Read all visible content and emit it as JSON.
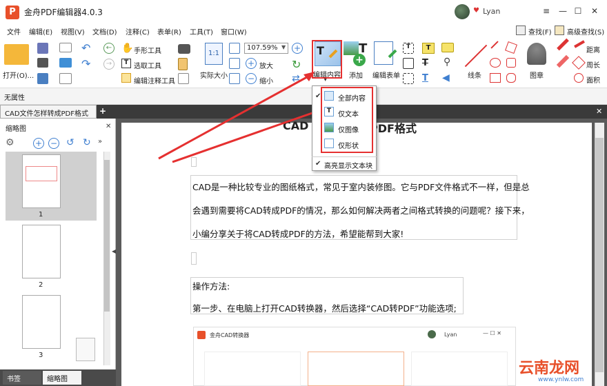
{
  "app": {
    "title": "金舟PDF编辑器4.0.3",
    "logo": "P",
    "user": "Lyan"
  },
  "window_controls": {
    "menu": "≡",
    "minimize": "—",
    "maximize": "☐",
    "close": "✕"
  },
  "menubar": [
    "文件",
    "编辑(E)",
    "视图(V)",
    "文档(D)",
    "注释(C)",
    "表单(R)",
    "工具(T)",
    "窗口(W)"
  ],
  "search": {
    "find": "查找(F)",
    "advanced": "高级查找(S)"
  },
  "ribbon": {
    "open": "打开(O)...",
    "hand_tool": "手形工具",
    "select_tool": "选取工具",
    "annot_tool": "编辑注释工具",
    "actual_size": "实际大小",
    "zoom_value": "107.59%",
    "zoom_in": "放大",
    "zoom_out": "缩小",
    "edit_content": "编辑内容",
    "add": "添加",
    "edit_form": "编辑表单",
    "line": "线条",
    "stamp": "图章",
    "distance": "距离",
    "perimeter": "周长",
    "area": "面积"
  },
  "propbar": {
    "label": "无属性"
  },
  "tabs": {
    "doc_tab": "CAD文件怎样转成PDF格式",
    "new_tab": "+",
    "close": "✕"
  },
  "sidebar": {
    "title": "缩略图",
    "close": "✕",
    "pages": [
      "1",
      "2",
      "3"
    ],
    "bottom_tabs": [
      "书签",
      "缩略图"
    ]
  },
  "dropdown": {
    "items": [
      "全部内容",
      "仅文本",
      "仅图像",
      "仅形状"
    ],
    "extra": "高亮显示文本块"
  },
  "document": {
    "heading_left": "CAD",
    "heading_right": "成PDF格式",
    "para1": [
      "CAD是一种比较专业的图纸格式，常见于室内装修图。它与PDF文件格式不一样，但是总",
      "会遇到需要将CAD转成PDF的情况，那么如何解决两者之间格式转换的问题呢？接下来，",
      "小编分享关于将CAD转成PDF的方法，希望能帮到大家!"
    ],
    "para2": [
      "操作方法:",
      "第一步、在电脑上打开CAD转换器，然后选择“CAD转PDF”功能选项;"
    ],
    "embedded": {
      "title": "金舟CAD转换器",
      "user": "Lyan"
    }
  },
  "watermark": {
    "text": "云南龙网",
    "sub": "www.ynlw.com"
  },
  "colors": {
    "accent_red": "#e53030",
    "tab_dark": "#3a3a3a",
    "logo": "#e8502a"
  }
}
